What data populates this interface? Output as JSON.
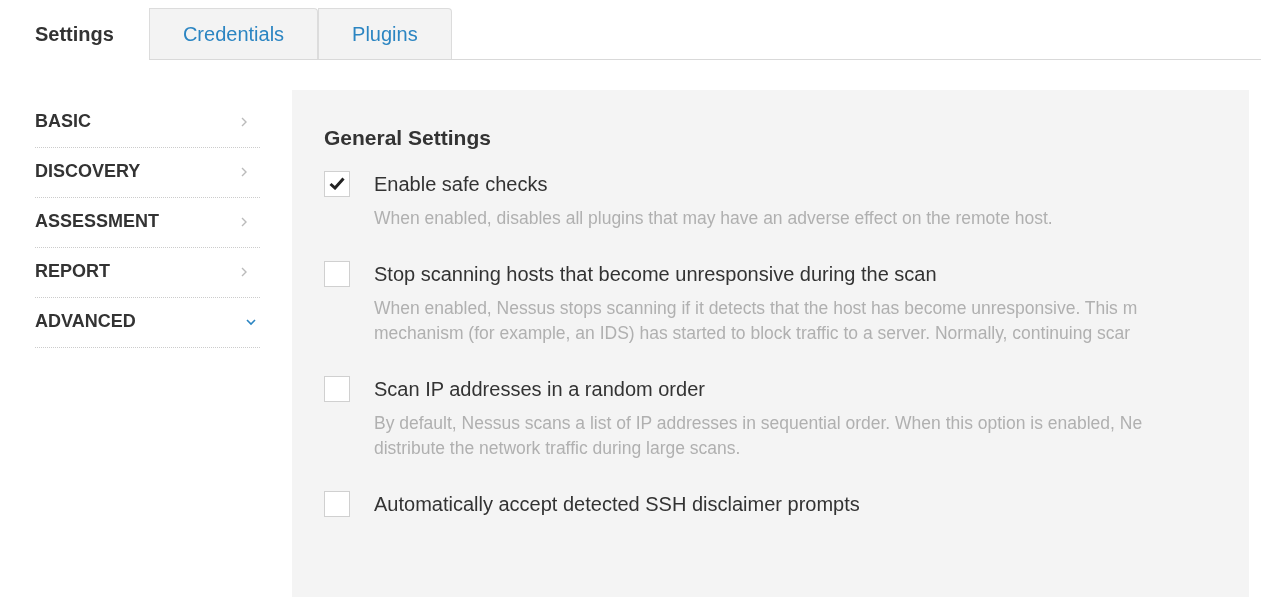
{
  "tabs": [
    {
      "label": "Settings",
      "selected": true
    },
    {
      "label": "Credentials",
      "selected": false
    },
    {
      "label": "Plugins",
      "selected": false
    }
  ],
  "sidebar": {
    "items": [
      {
        "label": "BASIC",
        "expanded": false
      },
      {
        "label": "DISCOVERY",
        "expanded": false
      },
      {
        "label": "ASSESSMENT",
        "expanded": false
      },
      {
        "label": "REPORT",
        "expanded": false
      },
      {
        "label": "ADVANCED",
        "expanded": true
      }
    ]
  },
  "panel": {
    "title": "General Settings",
    "options": [
      {
        "label": "Enable safe checks",
        "checked": true,
        "description": [
          "When enabled, disables all plugins that may have an adverse effect on the remote host."
        ]
      },
      {
        "label": "Stop scanning hosts that become unresponsive during the scan",
        "checked": false,
        "description": [
          "When enabled, Nessus stops scanning if it detects that the host has become unresponsive. This m",
          "mechanism (for example, an IDS) has started to block traffic to a server. Normally, continuing scar"
        ]
      },
      {
        "label": "Scan IP addresses in a random order",
        "checked": false,
        "description": [
          "By default, Nessus scans a list of IP addresses in sequential order. When this option is enabled, Ne",
          "distribute the network traffic during large scans."
        ]
      },
      {
        "label": "Automatically accept detected SSH disclaimer prompts",
        "checked": false
      }
    ]
  }
}
